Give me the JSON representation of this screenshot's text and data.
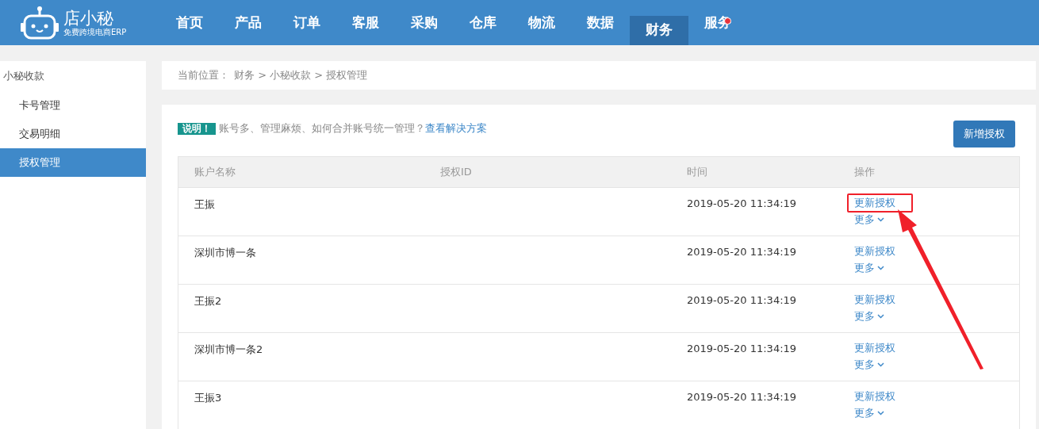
{
  "logo": {
    "name": "店小秘",
    "tagline": "免费跨境电商ERP"
  },
  "nav": [
    {
      "label": "首页",
      "selected": false,
      "badge": false
    },
    {
      "label": "产品",
      "selected": false,
      "badge": false
    },
    {
      "label": "订单",
      "selected": false,
      "badge": false
    },
    {
      "label": "客服",
      "selected": false,
      "badge": false
    },
    {
      "label": "采购",
      "selected": false,
      "badge": false
    },
    {
      "label": "仓库",
      "selected": false,
      "badge": false
    },
    {
      "label": "物流",
      "selected": false,
      "badge": false
    },
    {
      "label": "数据",
      "selected": false,
      "badge": false
    },
    {
      "label": "财务",
      "selected": true,
      "badge": false
    },
    {
      "label": "服务",
      "selected": false,
      "badge": true
    }
  ],
  "sidebar": {
    "title": "小秘收款",
    "items": [
      {
        "label": "卡号管理",
        "selected": false
      },
      {
        "label": "交易明细",
        "selected": false
      },
      {
        "label": "授权管理",
        "selected": true
      }
    ]
  },
  "breadcrumb": {
    "prefix": "当前位置：",
    "path": "财务 > 小秘收款 > 授权管理"
  },
  "notice": {
    "tag": "说明！",
    "text": "账号多、管理麻烦、如何合并账号统一管理？",
    "link": "查看解决方案"
  },
  "add_button": "新增授权",
  "table": {
    "columns": [
      "账户名称",
      "授权ID",
      "时间",
      "操作"
    ],
    "rows": [
      {
        "name": "王振",
        "time": "2019-05-20 11:34:19",
        "action": "更新授权",
        "more": "更多",
        "highlighted": true
      },
      {
        "name": "深圳市博一条",
        "time": "2019-05-20 11:34:19",
        "action": "更新授权",
        "more": "更多",
        "highlighted": false
      },
      {
        "name": "王振2",
        "time": "2019-05-20 11:34:19",
        "action": "更新授权",
        "more": "更多",
        "highlighted": false
      },
      {
        "name": "深圳市博一条2",
        "time": "2019-05-20 11:34:19",
        "action": "更新授权",
        "more": "更多",
        "highlighted": false
      },
      {
        "name": "王振3",
        "time": "2019-05-20 11:34:19",
        "action": "更新授权",
        "more": "更多",
        "highlighted": false
      }
    ]
  }
}
